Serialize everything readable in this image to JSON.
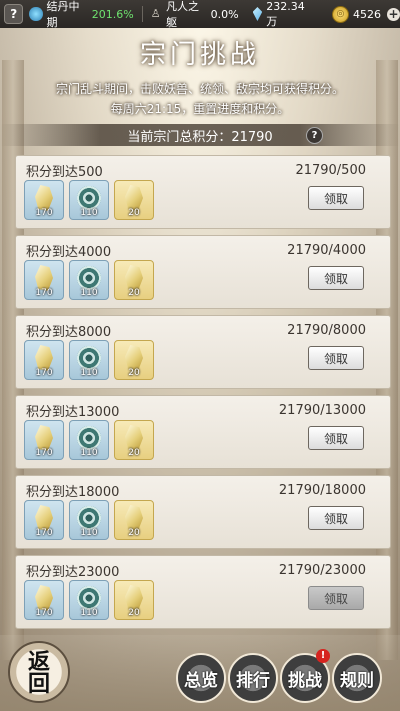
{
  "topbar": {
    "help_label": "?",
    "realm_name": "结丹中期",
    "realm_percent": "201.6%",
    "body_name": "凡人之躯",
    "body_percent": "0.0%",
    "gems": "232.34万",
    "coins": "4526",
    "plus_label": "+"
  },
  "header": {
    "title": "宗门挑战",
    "desc_line1": "宗门乱斗期间，击败妖兽、统领、敌宗均可获得积分。",
    "desc_line2": "每周六21:15，重置进度和积分。",
    "total_text": "当前宗门总积分：21790",
    "total_help": "?"
  },
  "rewards": [
    {
      "label": "积分到达500",
      "progress": "21790/500",
      "items": [
        {
          "type": "crystal-blue",
          "count": "170"
        },
        {
          "type": "swirl",
          "count": "110"
        },
        {
          "type": "crystal-gold",
          "count": "20"
        }
      ],
      "button": "领取",
      "disabled": false
    },
    {
      "label": "积分到达4000",
      "progress": "21790/4000",
      "items": [
        {
          "type": "crystal-blue",
          "count": "170"
        },
        {
          "type": "swirl",
          "count": "110"
        },
        {
          "type": "crystal-gold",
          "count": "20"
        }
      ],
      "button": "领取",
      "disabled": false
    },
    {
      "label": "积分到达8000",
      "progress": "21790/8000",
      "items": [
        {
          "type": "crystal-blue",
          "count": "170"
        },
        {
          "type": "swirl",
          "count": "110"
        },
        {
          "type": "crystal-gold",
          "count": "20"
        }
      ],
      "button": "领取",
      "disabled": false
    },
    {
      "label": "积分到达13000",
      "progress": "21790/13000",
      "items": [
        {
          "type": "crystal-blue",
          "count": "170"
        },
        {
          "type": "swirl",
          "count": "110"
        },
        {
          "type": "crystal-gold",
          "count": "20"
        }
      ],
      "button": "领取",
      "disabled": false
    },
    {
      "label": "积分到达18000",
      "progress": "21790/18000",
      "items": [
        {
          "type": "crystal-blue",
          "count": "170"
        },
        {
          "type": "swirl",
          "count": "110"
        },
        {
          "type": "crystal-gold",
          "count": "20"
        }
      ],
      "button": "领取",
      "disabled": false
    },
    {
      "label": "积分到达23000",
      "progress": "21790/23000",
      "items": [
        {
          "type": "crystal-blue",
          "count": "170"
        },
        {
          "type": "swirl",
          "count": "110"
        },
        {
          "type": "crystal-gold",
          "count": "20"
        }
      ],
      "button": "领取",
      "disabled": true
    }
  ],
  "bottom": {
    "back_label": "返回",
    "overview_label": "总览",
    "rank_label": "排行",
    "challenge_label": "挑战",
    "rules_label": "规则",
    "badge": "!"
  }
}
